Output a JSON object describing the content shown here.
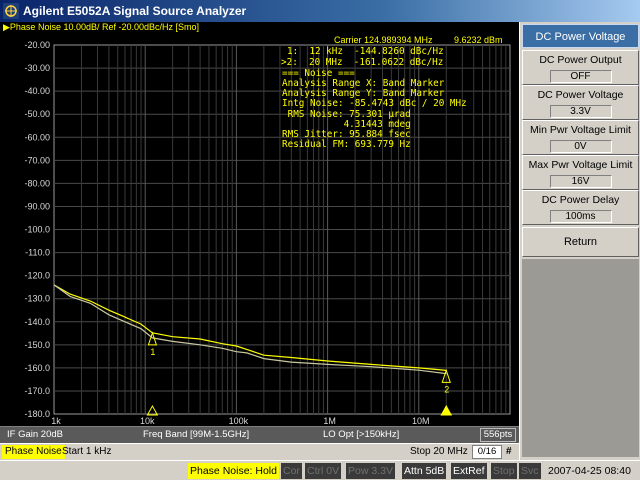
{
  "window": {
    "title": "Agilent E5052A Signal Source Analyzer"
  },
  "trace": {
    "header": "Phase Noise 10.00dB/ Ref -20.00dBc/Hz [Smo]",
    "carrier_freq": "Carrier 124.989394 MHz",
    "carrier_power": "9.6232 dBm",
    "markers": [
      {
        "line": "1:  12 kHz  -144.8260 dBc/Hz",
        "label": "1",
        "freq_hz": 12000,
        "value_dbc": -144.826
      },
      {
        "line": ">2:  20 MHz  -161.0622 dBc/Hz",
        "label": "2",
        "freq_hz": 20000000,
        "value_dbc": -161.0622
      }
    ],
    "noise_block": [
      "=== Noise ===",
      "Analysis Range X: Band Marker",
      "Analysis Range Y: Band Marker",
      "Intg Noise: -85.4743 dBc / 20 MHz",
      " RMS Noise: 75.301 µrad",
      "           4.31443 mdeg",
      "RMS Jitter: 95.884 fsec",
      "Residual FM: 693.779 Hz"
    ]
  },
  "axes": {
    "y_ticks": [
      "-20.00",
      "-30.00",
      "-40.00",
      "-50.00",
      "-60.00",
      "-70.00",
      "-80.00",
      "-90.00",
      "-100.0",
      "-110.0",
      "-120.0",
      "-130.0",
      "-140.0",
      "-150.0",
      "-160.0",
      "-170.0",
      "-180.0"
    ],
    "x_ticks": [
      {
        "label": "1k",
        "freq_hz": 1000
      },
      {
        "label": "10k",
        "freq_hz": 10000
      },
      {
        "label": "100k",
        "freq_hz": 100000
      },
      {
        "label": "1M",
        "freq_hz": 1000000
      },
      {
        "label": "10M",
        "freq_hz": 10000000
      }
    ]
  },
  "chart_data": {
    "type": "line",
    "x_scale": "log",
    "xlim_hz": [
      1000,
      20000000
    ],
    "ylim": [
      -180,
      -20
    ],
    "grid": true,
    "series": [
      {
        "color": "#ffff00",
        "x": [
          1000,
          1500,
          2500,
          4000,
          6000,
          9000,
          12000,
          20000,
          40000,
          70000,
          100000,
          130000,
          200000,
          400000,
          1000000,
          3000000,
          10000000,
          20000000
        ],
        "y": [
          -124,
          -128,
          -131,
          -135,
          -138,
          -141,
          -144.8,
          -146.5,
          -147.5,
          -149.5,
          -150.5,
          -152,
          -154.5,
          -155.5,
          -157,
          -158.5,
          -160,
          -161.1
        ]
      },
      {
        "color": "#c8c8a0",
        "x": [
          1000,
          1500,
          2500,
          4000,
          6000,
          9000,
          12000,
          20000,
          40000,
          70000,
          100000,
          130000,
          200000,
          400000,
          1000000,
          3000000,
          10000000,
          20000000
        ],
        "y": [
          -124,
          -129,
          -132,
          -137,
          -140,
          -143,
          -147,
          -148.5,
          -150,
          -151.5,
          -153,
          -153.5,
          -156,
          -157.5,
          -158.5,
          -159.5,
          -161,
          -162.5
        ]
      }
    ]
  },
  "info": {
    "if_gain": "IF Gain 20dB",
    "freq_band": "Freq Band [99M-1.5GHz]",
    "lo_opt": "LO Opt [>150kHz]",
    "points": "556pts"
  },
  "measure": {
    "mode": "Phase Noise",
    "start": "Start 1 kHz",
    "stop": "Stop 20 MHz",
    "page": "0/16",
    "hash": "#"
  },
  "status": {
    "hold": "Phase Noise: Hold",
    "cor": "Cor",
    "ctrl": "Ctrl  0V",
    "pow": "Pow  3.3V",
    "attn": "Attn 5dB",
    "extref": "ExtRef",
    "stop": "Stop",
    "svc": "Svc",
    "datetime": "2007-04-25 08:40"
  },
  "softkeys": {
    "title": "DC Power Voltage",
    "items": [
      {
        "label": "DC Power Output",
        "value": "OFF"
      },
      {
        "label": "DC Power Voltage",
        "value": "3.3V"
      },
      {
        "label": "Min Pwr Voltage Limit",
        "value": "0V"
      },
      {
        "label": "Max Pwr Voltage Limit",
        "value": "16V"
      },
      {
        "label": "DC Power Delay",
        "value": "100ms"
      }
    ],
    "return_label": "Return"
  }
}
